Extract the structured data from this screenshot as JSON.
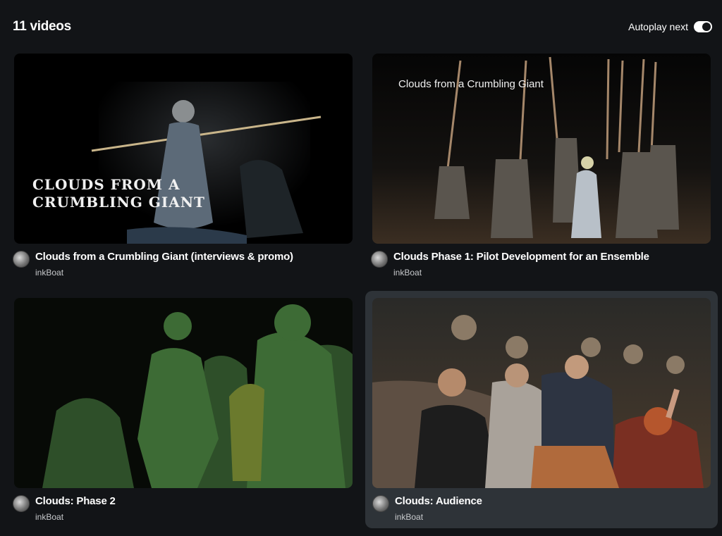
{
  "header": {
    "count_label": "11 videos",
    "autoplay_label": "Autoplay next",
    "autoplay_on": true
  },
  "videos": [
    {
      "title": "Clouds from a Crumbling Giant (interviews & promo)",
      "channel": "inkBoat",
      "overlay_line1": "CLOUDS FROM A",
      "overlay_line2": "CRUMBLING GIANT",
      "active": false
    },
    {
      "title": "Clouds Phase 1: Pilot Development for an Ensemble",
      "channel": "inkBoat",
      "overlay_text": "Clouds from a Crumbling Giant",
      "active": false
    },
    {
      "title": "Clouds: Phase 2",
      "channel": "inkBoat",
      "active": false
    },
    {
      "title": "Clouds: Audience",
      "channel": "inkBoat",
      "active": true
    }
  ],
  "colors": {
    "background": "#121417",
    "active_card": "#2e3338",
    "phase2_tint": "#3d6b35"
  }
}
